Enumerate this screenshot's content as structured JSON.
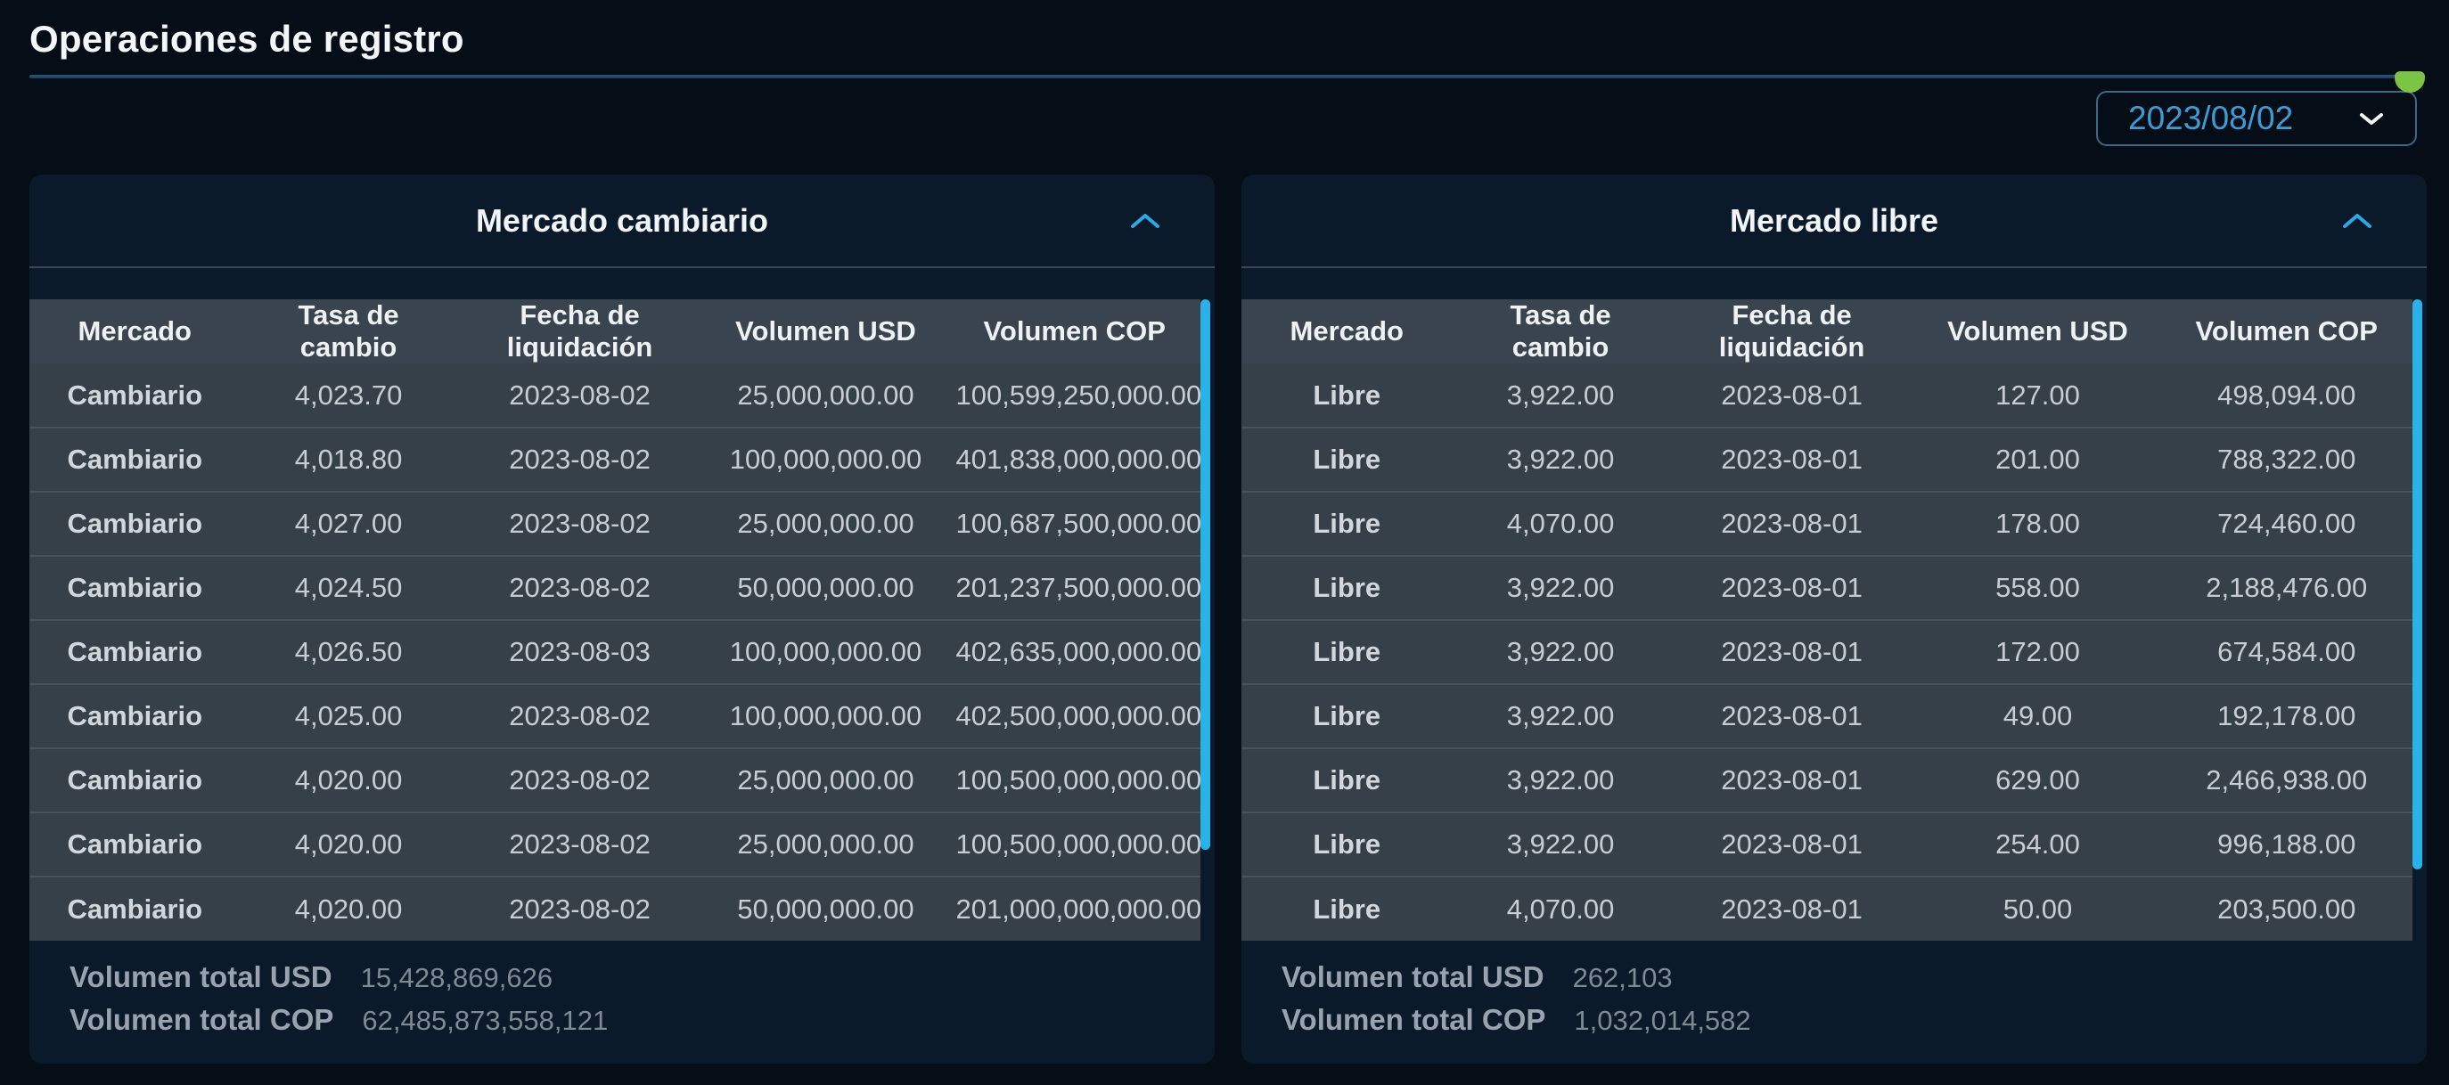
{
  "page": {
    "title": "Operaciones de registro"
  },
  "date_filter": {
    "value": "2023/08/02"
  },
  "columns": [
    "Mercado",
    "Tasa de cambio",
    "Fecha de liquidación",
    "Volumen USD",
    "Volumen COP"
  ],
  "totals_labels": {
    "usd": "Volumen total USD",
    "cop": "Volumen total COP"
  },
  "left_panel": {
    "title": "Mercado cambiario",
    "rows": [
      {
        "mercado": "Cambiario",
        "tasa": "4,023.70",
        "fecha": "2023-08-02",
        "vol_usd": "25,000,000.00",
        "vol_cop": "100,599,250,000.00"
      },
      {
        "mercado": "Cambiario",
        "tasa": "4,018.80",
        "fecha": "2023-08-02",
        "vol_usd": "100,000,000.00",
        "vol_cop": "401,838,000,000.00"
      },
      {
        "mercado": "Cambiario",
        "tasa": "4,027.00",
        "fecha": "2023-08-02",
        "vol_usd": "25,000,000.00",
        "vol_cop": "100,687,500,000.00"
      },
      {
        "mercado": "Cambiario",
        "tasa": "4,024.50",
        "fecha": "2023-08-02",
        "vol_usd": "50,000,000.00",
        "vol_cop": "201,237,500,000.00"
      },
      {
        "mercado": "Cambiario",
        "tasa": "4,026.50",
        "fecha": "2023-08-03",
        "vol_usd": "100,000,000.00",
        "vol_cop": "402,635,000,000.00"
      },
      {
        "mercado": "Cambiario",
        "tasa": "4,025.00",
        "fecha": "2023-08-02",
        "vol_usd": "100,000,000.00",
        "vol_cop": "402,500,000,000.00"
      },
      {
        "mercado": "Cambiario",
        "tasa": "4,020.00",
        "fecha": "2023-08-02",
        "vol_usd": "25,000,000.00",
        "vol_cop": "100,500,000,000.00"
      },
      {
        "mercado": "Cambiario",
        "tasa": "4,020.00",
        "fecha": "2023-08-02",
        "vol_usd": "25,000,000.00",
        "vol_cop": "100,500,000,000.00"
      },
      {
        "mercado": "Cambiario",
        "tasa": "4,020.00",
        "fecha": "2023-08-02",
        "vol_usd": "50,000,000.00",
        "vol_cop": "201,000,000,000.00"
      }
    ],
    "totals": {
      "usd": "15,428,869,626",
      "cop": "62,485,873,558,121"
    }
  },
  "right_panel": {
    "title": "Mercado libre",
    "rows": [
      {
        "mercado": "Libre",
        "tasa": "3,922.00",
        "fecha": "2023-08-01",
        "vol_usd": "127.00",
        "vol_cop": "498,094.00"
      },
      {
        "mercado": "Libre",
        "tasa": "3,922.00",
        "fecha": "2023-08-01",
        "vol_usd": "201.00",
        "vol_cop": "788,322.00"
      },
      {
        "mercado": "Libre",
        "tasa": "4,070.00",
        "fecha": "2023-08-01",
        "vol_usd": "178.00",
        "vol_cop": "724,460.00"
      },
      {
        "mercado": "Libre",
        "tasa": "3,922.00",
        "fecha": "2023-08-01",
        "vol_usd": "558.00",
        "vol_cop": "2,188,476.00"
      },
      {
        "mercado": "Libre",
        "tasa": "3,922.00",
        "fecha": "2023-08-01",
        "vol_usd": "172.00",
        "vol_cop": "674,584.00"
      },
      {
        "mercado": "Libre",
        "tasa": "3,922.00",
        "fecha": "2023-08-01",
        "vol_usd": "49.00",
        "vol_cop": "192,178.00"
      },
      {
        "mercado": "Libre",
        "tasa": "3,922.00",
        "fecha": "2023-08-01",
        "vol_usd": "629.00",
        "vol_cop": "2,466,938.00"
      },
      {
        "mercado": "Libre",
        "tasa": "3,922.00",
        "fecha": "2023-08-01",
        "vol_usd": "254.00",
        "vol_cop": "996,188.00"
      },
      {
        "mercado": "Libre",
        "tasa": "4,070.00",
        "fecha": "2023-08-01",
        "vol_usd": "50.00",
        "vol_cop": "203,500.00"
      }
    ],
    "totals": {
      "usd": "262,103",
      "cop": "1,032,014,582"
    }
  },
  "colors": {
    "accent_scrollbar": "#27b3e8",
    "date_text": "#3e9bd4",
    "status_green": "#7cc444",
    "page_background": "#050d17",
    "card_background": "#0a1a2b",
    "table_row": "#364049"
  }
}
